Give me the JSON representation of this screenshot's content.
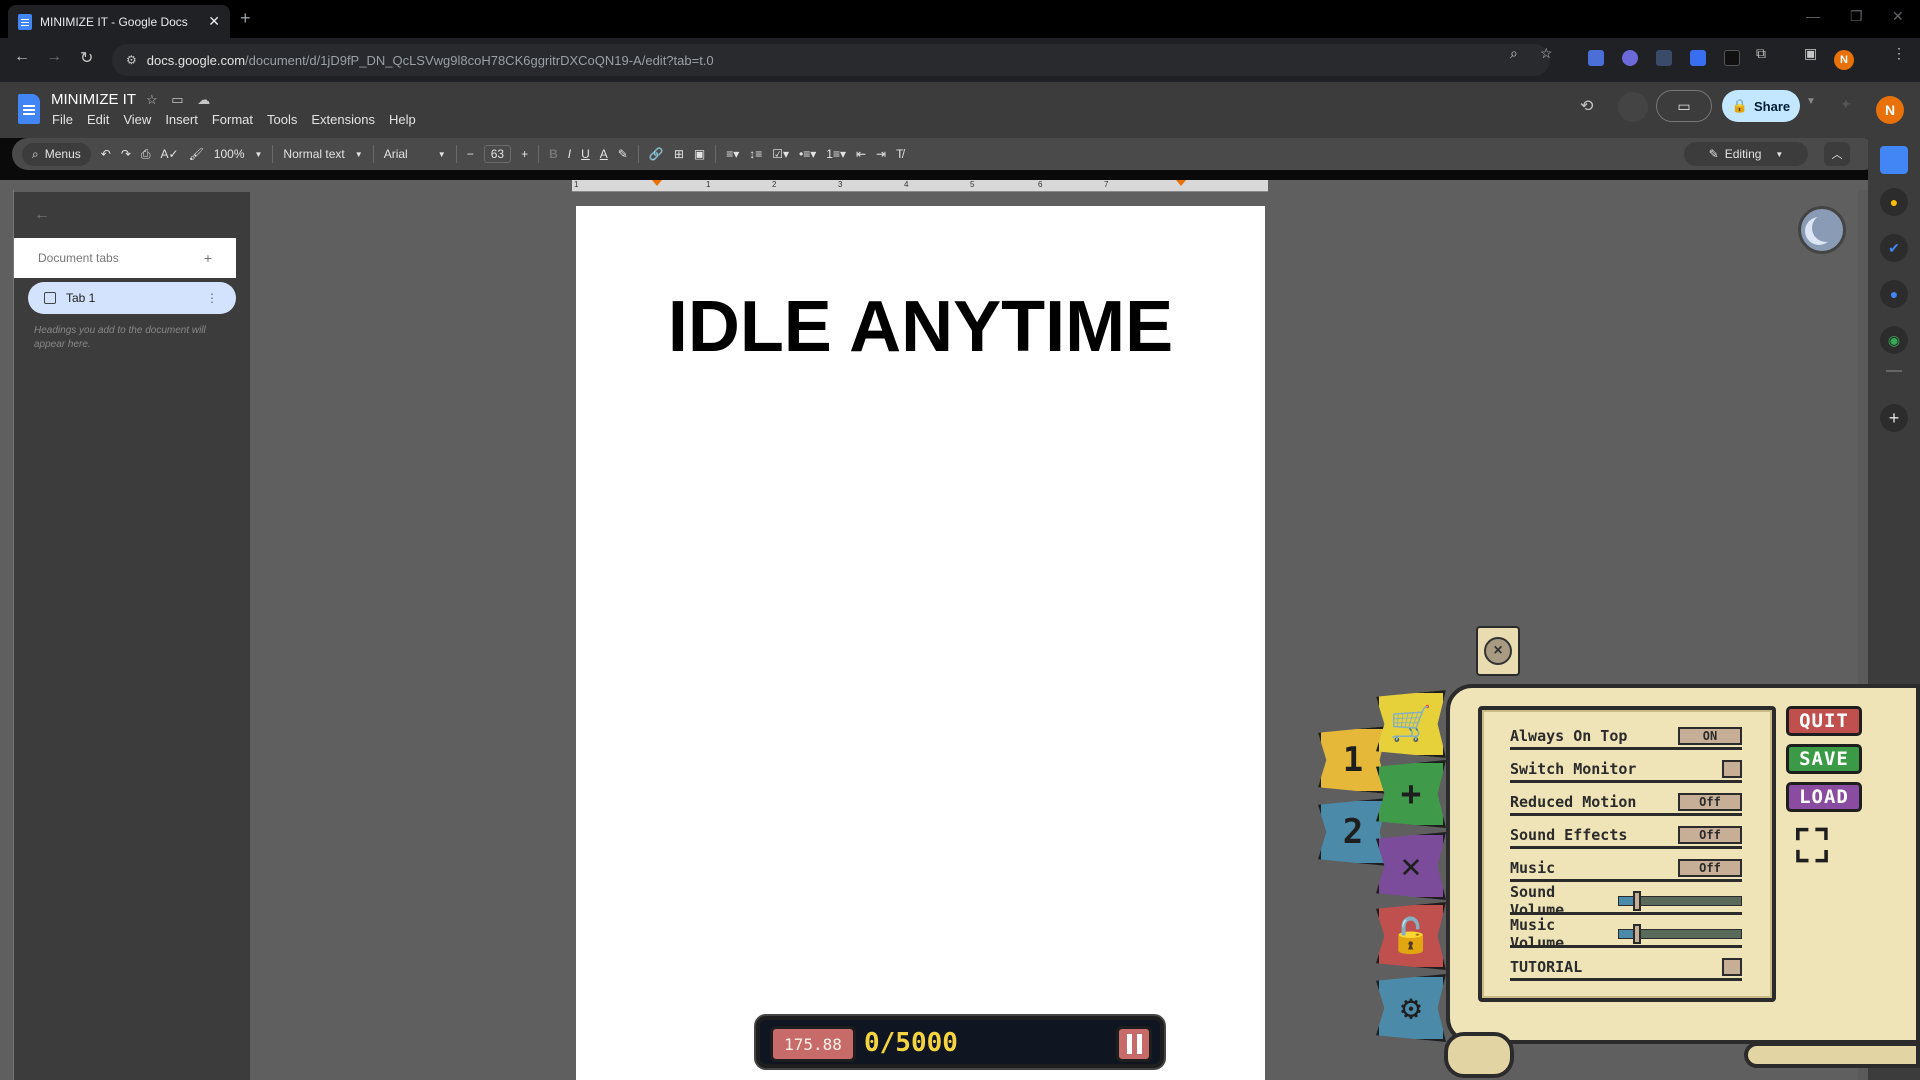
{
  "browser": {
    "tab_title": "MINIMIZE IT - Google Docs",
    "url_host": "docs.google.com",
    "url_path": "/document/d/1jD9fP_DN_QcLSVwg9l8coH78CK6ggritrDXCoQN19-A/edit?tab=t.0",
    "profile_initial": "N"
  },
  "docs": {
    "title": "MINIMIZE IT",
    "menu": [
      "File",
      "Edit",
      "View",
      "Insert",
      "Format",
      "Tools",
      "Extensions",
      "Help"
    ],
    "share_label": "Share",
    "toolbar": {
      "menus_label": "Menus",
      "zoom": "100%",
      "style": "Normal text",
      "font": "Arial",
      "font_size": "63",
      "editing_label": "Editing"
    },
    "sidebar": {
      "section_title": "Document tabs",
      "tab_label": "Tab 1",
      "hint": "Headings you add to the document will appear here."
    },
    "page_heading": "IDLE ANYTIME",
    "ruler_labels": [
      "1",
      "1",
      "2",
      "3",
      "4",
      "5",
      "6",
      "7"
    ]
  },
  "game": {
    "settings": [
      {
        "label": "Always On Top",
        "control": "toggle",
        "value": "ON"
      },
      {
        "label": "Switch Monitor",
        "control": "checkbox"
      },
      {
        "label": "Reduced Motion",
        "control": "toggle",
        "value": "Off"
      },
      {
        "label": "Sound Effects",
        "control": "toggle",
        "value": "Off"
      },
      {
        "label": "Music",
        "control": "toggle",
        "value": "Off"
      },
      {
        "label": "Sound Volume",
        "control": "slider",
        "level": 0.15
      },
      {
        "label": "Music Volume",
        "control": "slider",
        "level": 0.15
      },
      {
        "label": "TUTORIAL",
        "control": "checkbox"
      }
    ],
    "buttons": {
      "quit": "QUIT",
      "save": "SAVE",
      "load": "LOAD"
    },
    "button_colors": {
      "quit": "#c0504d",
      "save": "#3a9a45",
      "load": "#8a4ca0"
    },
    "tabs": [
      {
        "glyph": "1",
        "icon": "number-one-icon",
        "color": "#e6b83a"
      },
      {
        "glyph": "2",
        "icon": "number-two-icon",
        "color": "#4b8aa8"
      },
      {
        "glyph": "🛒",
        "icon": "cart-icon",
        "color": "#e6d13a"
      },
      {
        "glyph": "+",
        "icon": "plus-icon",
        "color": "#3f9a4a"
      },
      {
        "glyph": "✕",
        "icon": "multiply-icon",
        "color": "#7a4c9a"
      },
      {
        "glyph": "🔓",
        "icon": "unlock-icon",
        "color": "#c0504d"
      },
      {
        "glyph": "⚙",
        "icon": "gear-icon",
        "color": "#4b8aa8"
      }
    ],
    "hud": {
      "money": "175.88",
      "progress": "0/5000"
    }
  }
}
